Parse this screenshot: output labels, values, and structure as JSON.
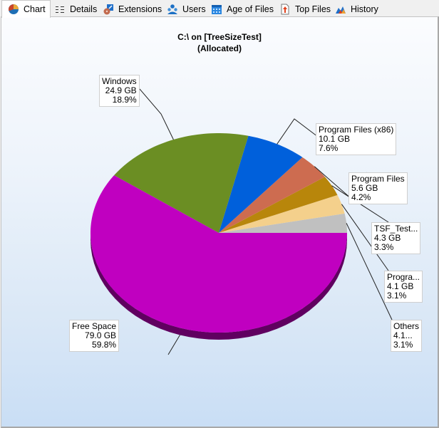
{
  "tabs": [
    {
      "label": "Chart",
      "icon": "pie-chart-icon",
      "active": true
    },
    {
      "label": "Details",
      "icon": "details-list-icon",
      "active": false
    },
    {
      "label": "Extensions",
      "icon": "extensions-icon",
      "active": false
    },
    {
      "label": "Users",
      "icon": "users-icon",
      "active": false
    },
    {
      "label": "Age of Files",
      "icon": "calendar-icon",
      "active": false
    },
    {
      "label": "Top Files",
      "icon": "top-files-icon",
      "active": false
    },
    {
      "label": "History",
      "icon": "history-icon",
      "active": false
    }
  ],
  "chart_data": {
    "type": "pie",
    "title": "C:\\  on  [TreeSizeTest]",
    "subtitle": "(Allocated)",
    "unit": "GB",
    "slices": [
      {
        "label": "Free Space",
        "size": "79.0 GB",
        "percent": 59.8,
        "percent_label": "59.8%",
        "color": "#c000c0"
      },
      {
        "label": "Windows",
        "size": "24.9 GB",
        "percent": 18.9,
        "percent_label": "18.9%",
        "color": "#6b8e23"
      },
      {
        "label": "Program Files (x86)",
        "size": "10.1 GB",
        "percent": 7.6,
        "percent_label": "7.6%",
        "color": "#0060db"
      },
      {
        "label": "Program Files",
        "size": "5.6 GB",
        "percent": 4.2,
        "percent_label": "4.2%",
        "color": "#cd6c50"
      },
      {
        "label": "TSF_Test...",
        "size": "4.3 GB",
        "percent": 3.3,
        "percent_label": "3.3%",
        "color": "#b8860b"
      },
      {
        "label": "Progra...",
        "size": "4.1 GB",
        "percent": 3.1,
        "percent_label": "3.1%",
        "color": "#f4d08c"
      },
      {
        "label": "Others",
        "size": "4.1...",
        "percent": 3.1,
        "percent_label": "3.1%",
        "color": "#c0c0c0"
      }
    ]
  }
}
